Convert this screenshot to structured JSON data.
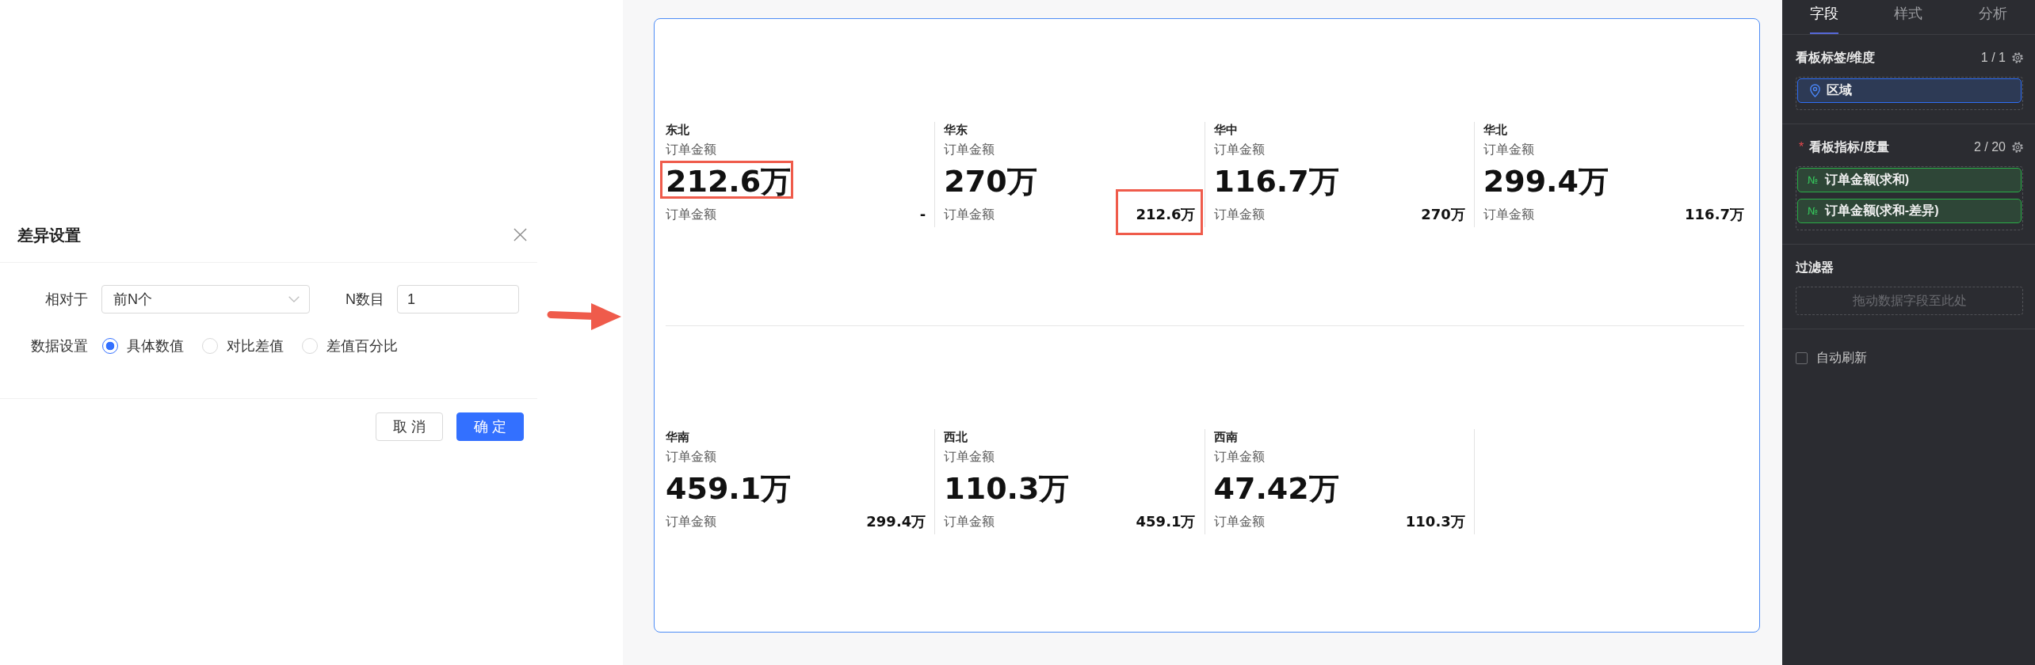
{
  "dialog": {
    "title": "差异设置",
    "relative_to": {
      "label": "相对于",
      "value": "前N个"
    },
    "n_count": {
      "label": "N数目",
      "value": "1"
    },
    "data_setting": {
      "label": "数据设置",
      "options": [
        {
          "label": "具体数值",
          "selected": true
        },
        {
          "label": "对比差值",
          "selected": false
        },
        {
          "label": "差值百分比",
          "selected": false
        }
      ]
    },
    "buttons": [
      {
        "label": "取 消",
        "kind": "default"
      },
      {
        "label": "确 定",
        "kind": "primary"
      }
    ]
  },
  "board": {
    "rows": [
      {
        "cards": [
          {
            "region": "东北",
            "metric": "订单金额",
            "value": "212.6万",
            "compare_label": "订单金额",
            "compare_value": "-",
            "value_highlighted": true,
            "compare_highlighted": false
          },
          {
            "region": "华东",
            "metric": "订单金额",
            "value": "270万",
            "compare_label": "订单金额",
            "compare_value": "212.6万",
            "value_highlighted": false,
            "compare_highlighted": true
          },
          {
            "region": "华中",
            "metric": "订单金额",
            "value": "116.7万",
            "compare_label": "订单金额",
            "compare_value": "270万",
            "value_highlighted": false,
            "compare_highlighted": false
          },
          {
            "region": "华北",
            "metric": "订单金额",
            "value": "299.4万",
            "compare_label": "订单金额",
            "compare_value": "116.7万",
            "value_highlighted": false,
            "compare_highlighted": false
          }
        ]
      },
      {
        "cards": [
          {
            "region": "华南",
            "metric": "订单金额",
            "value": "459.1万",
            "compare_label": "订单金额",
            "compare_value": "299.4万",
            "value_highlighted": false,
            "compare_highlighted": false
          },
          {
            "region": "西北",
            "metric": "订单金额",
            "value": "110.3万",
            "compare_label": "订单金额",
            "compare_value": "459.1万",
            "value_highlighted": false,
            "compare_highlighted": false
          },
          {
            "region": "西南",
            "metric": "订单金额",
            "value": "47.42万",
            "compare_label": "订单金额",
            "compare_value": "110.3万",
            "value_highlighted": false,
            "compare_highlighted": false
          }
        ]
      }
    ]
  },
  "panel": {
    "tabs": [
      {
        "label": "字段",
        "selected": true
      },
      {
        "label": "样式",
        "selected": false
      },
      {
        "label": "分析",
        "selected": false
      }
    ],
    "sections": [
      {
        "kind": "dimension",
        "title": "看板标签/维度",
        "count": "1 / 1",
        "items": [
          {
            "label": "区域"
          }
        ]
      },
      {
        "kind": "measure",
        "required_mark": "*",
        "title": "看板指标/度量",
        "count": "2 / 20",
        "items": [
          {
            "label": "订单金额(求和)",
            "type_mark": "№"
          },
          {
            "label": "订单金额(求和-差异)",
            "type_mark": "№"
          }
        ]
      },
      {
        "kind": "filter",
        "title": "过滤器",
        "placeholder": "拖动数据字段至此处"
      }
    ],
    "auto_refresh": {
      "label": "自动刷新",
      "checked": false
    }
  }
}
